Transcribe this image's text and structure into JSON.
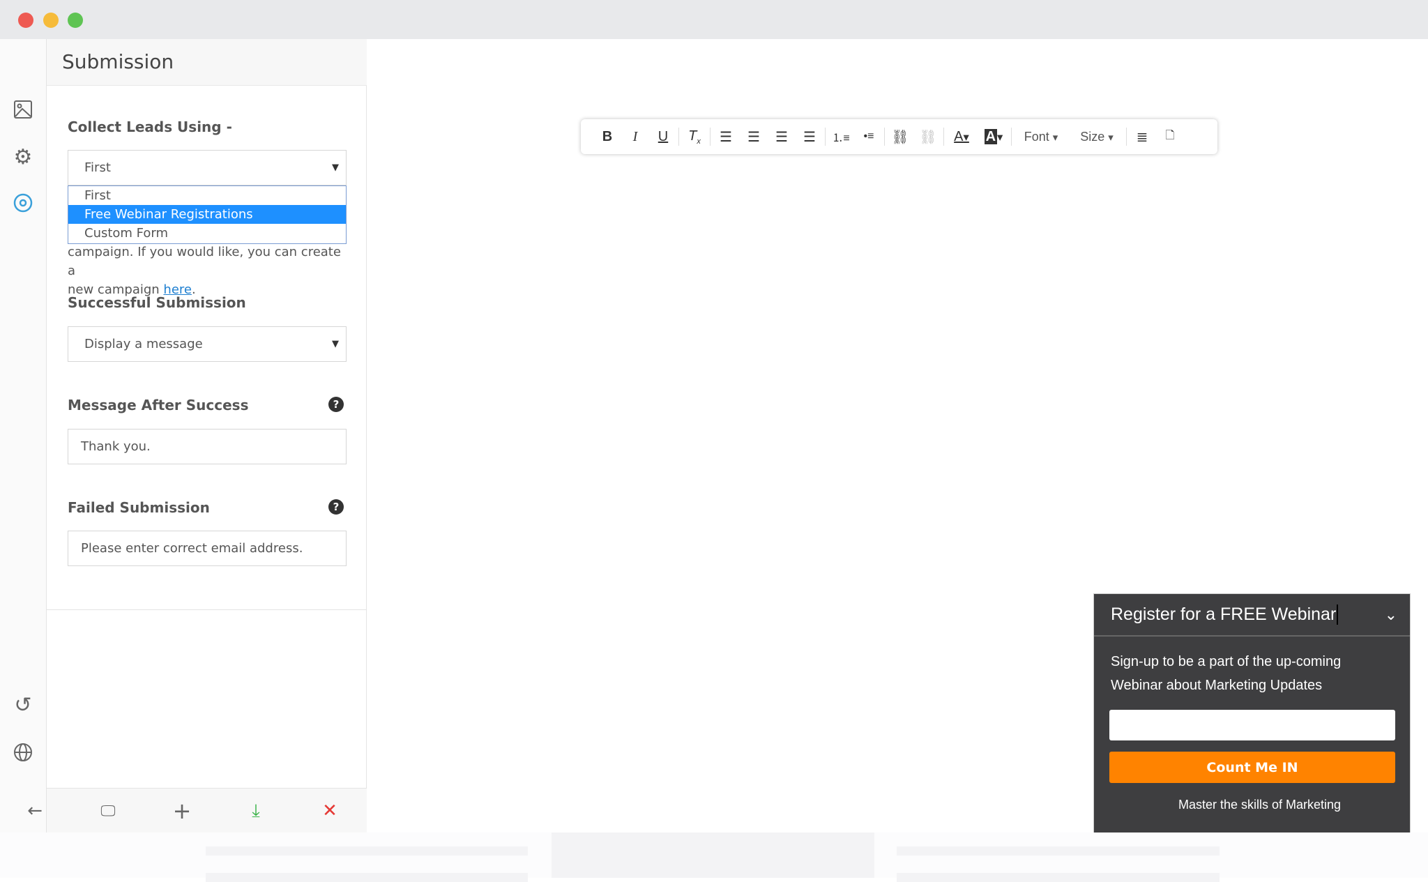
{
  "window": {
    "controls": {
      "close_color": "#ee5a52",
      "minimize_color": "#f6bb3a",
      "maximize_color": "#5fc453"
    }
  },
  "rail": {
    "icons": [
      "image-icon",
      "gear-icon",
      "target-icon",
      "history-icon",
      "globe-icon"
    ],
    "accent": "#3aa0da"
  },
  "panel": {
    "title": "Submission",
    "collect_label": "Collect Leads Using -",
    "collect_value": "First",
    "collect_options": [
      "First",
      "Free Webinar Registrations",
      "Custom Form"
    ],
    "collect_highlighted": "Free Webinar Registrations",
    "hint_line1": "campaign. If you would like, you can create a",
    "hint_line2": "new campaign ",
    "hint_link": "here",
    "hint_end": ".",
    "success_label": "Successful Submission",
    "success_value": "Display a message",
    "message_label": "Message After Success",
    "message_value": "Thank you.",
    "failed_label": "Failed Submission",
    "failed_value": "Please enter correct email address."
  },
  "editor_toolbar": {
    "font_label": "Font",
    "size_label": "Size"
  },
  "widget": {
    "title": "Register for a FREE Webinar",
    "body_line1": "Sign-up to be a part of the up-coming",
    "body_line2": "Webinar about Marketing Updates",
    "email_value": "",
    "button_label": "Count Me IN",
    "button_color": "#ff8300",
    "footer": "Master the skills of Marketing"
  }
}
